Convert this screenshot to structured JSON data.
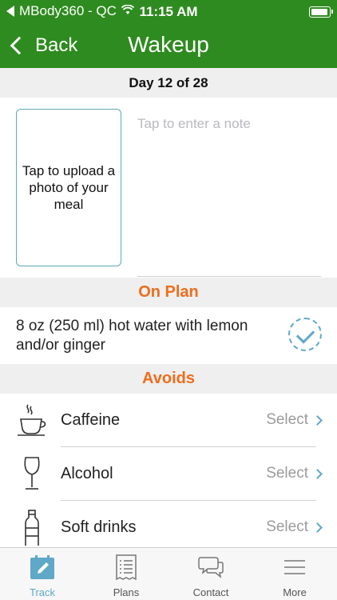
{
  "status_bar": {
    "carrier": "MBody360 - QC",
    "time": "11:15 AM"
  },
  "nav": {
    "back_label": "Back",
    "title": "Wakeup"
  },
  "day_label": "Day 12 of 28",
  "photo": {
    "prompt": "Tap to upload a photo of your meal"
  },
  "note": {
    "placeholder": "Tap to enter a note"
  },
  "on_plan": {
    "header": "On Plan",
    "item_text": "8 oz (250 ml) hot water with lemon and/or ginger",
    "checked": true
  },
  "avoids": {
    "header": "Avoids",
    "items": [
      {
        "label": "Caffeine",
        "select_label": "Select",
        "icon": "coffee-cup-icon"
      },
      {
        "label": "Alcohol",
        "select_label": "Select",
        "icon": "wine-glass-icon"
      },
      {
        "label": "Soft drinks",
        "select_label": "Select",
        "icon": "soda-bottle-icon"
      }
    ]
  },
  "tabs": [
    {
      "label": "Track",
      "icon": "calendar-edit-icon",
      "active": true
    },
    {
      "label": "Plans",
      "icon": "document-list-icon",
      "active": false
    },
    {
      "label": "Contact",
      "icon": "chat-bubbles-icon",
      "active": false
    },
    {
      "label": "More",
      "icon": "menu-lines-icon",
      "active": false
    }
  ],
  "colors": {
    "brand_green": "#2e8b1f",
    "accent_orange": "#ee6e1c",
    "accent_blue": "#5fa8c8",
    "section_bg": "#efefef"
  }
}
